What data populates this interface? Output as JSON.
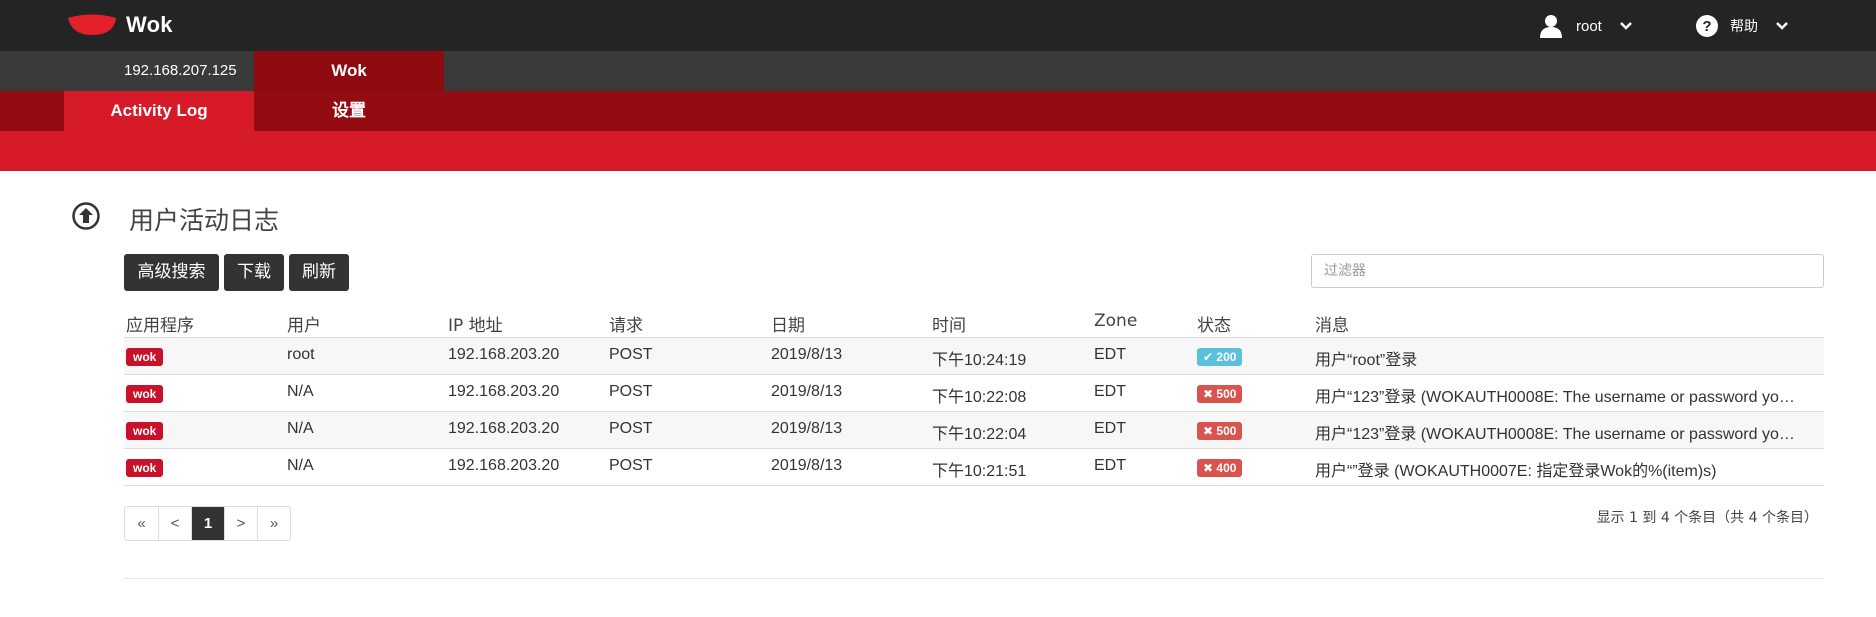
{
  "navbar": {
    "brand": "Wok",
    "user": "root",
    "help": "帮助",
    "colors": {
      "background": "#242424",
      "logo": "#e4212b"
    }
  },
  "host": {
    "ip": "192.168.207.125",
    "tab": "Wok"
  },
  "tabs": [
    {
      "label": "Activity Log",
      "active": true
    },
    {
      "label": "设置",
      "active": false
    }
  ],
  "section": {
    "title": "用户活动日志",
    "toggle_icon": "arrow-up-circle-icon"
  },
  "toolbar": {
    "advanced_search": "高级搜索",
    "download": "下载",
    "refresh": "刷新",
    "filter_placeholder": "过滤器"
  },
  "table": {
    "headers": [
      "应用程序",
      "用户",
      "IP 地址",
      "请求",
      "日期",
      "时间",
      "Zone",
      "状态",
      "消息"
    ],
    "rows": [
      {
        "app": "wok",
        "user": "root",
        "ip": "192.168.203.20",
        "request": "POST",
        "date": "2019/8/13",
        "time": "下午10:24:19",
        "zone": "EDT",
        "status": "200",
        "status_icon": "check-icon",
        "status_kind": "success",
        "message": "用户“root”登录"
      },
      {
        "app": "wok",
        "user": "N/A",
        "ip": "192.168.203.20",
        "request": "POST",
        "date": "2019/8/13",
        "time": "下午10:22:08",
        "zone": "EDT",
        "status": "500",
        "status_icon": "x-icon",
        "status_kind": "error",
        "message": "用户“123”登录 (WOKAUTH0008E: The username or password yo…"
      },
      {
        "app": "wok",
        "user": "N/A",
        "ip": "192.168.203.20",
        "request": "POST",
        "date": "2019/8/13",
        "time": "下午10:22:04",
        "zone": "EDT",
        "status": "500",
        "status_icon": "x-icon",
        "status_kind": "error",
        "message": "用户“123”登录 (WOKAUTH0008E: The username or password yo…"
      },
      {
        "app": "wok",
        "user": "N/A",
        "ip": "192.168.203.20",
        "request": "POST",
        "date": "2019/8/13",
        "time": "下午10:21:51",
        "zone": "EDT",
        "status": "400",
        "status_icon": "x-icon",
        "status_kind": "error",
        "message": "用户“”登录 (WOKAUTH0007E: 指定登录Wok的%(item)s)"
      }
    ]
  },
  "pagination": {
    "first": "«",
    "prev": "<",
    "current": "1",
    "next": ">",
    "last": "»",
    "info": "显示 1 到 4 个条目（共 4 个条目）"
  }
}
